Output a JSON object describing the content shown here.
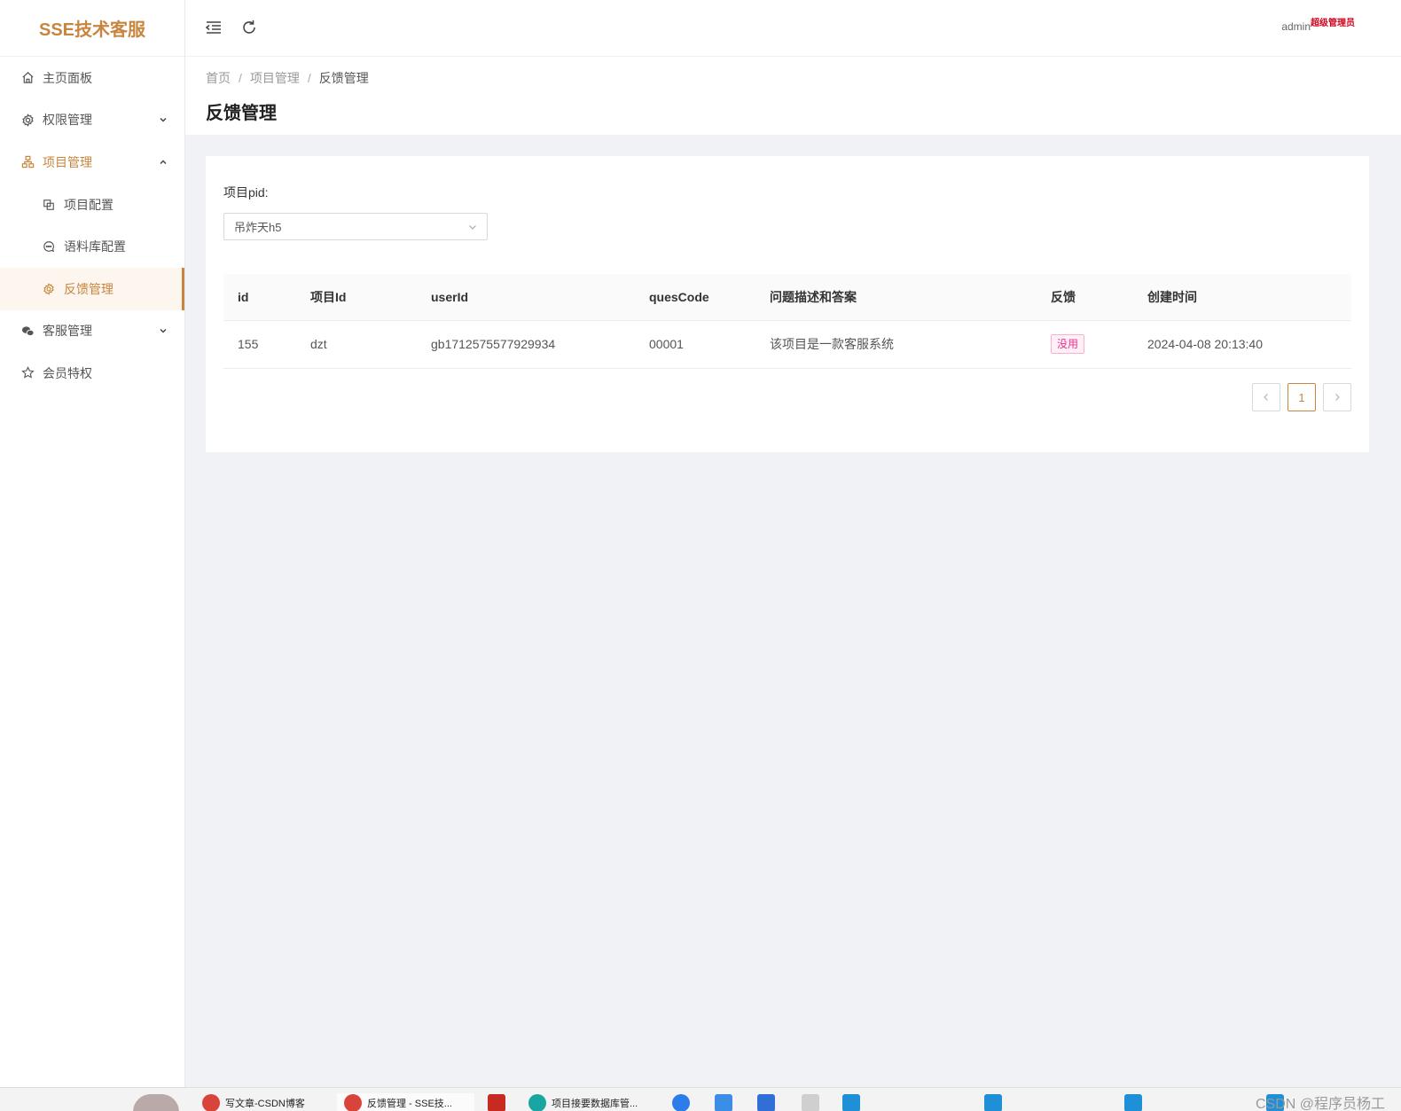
{
  "app": {
    "logo_text": "SSE技术客服",
    "accent_color": "#c8853f"
  },
  "sidebar": {
    "items": [
      {
        "label": "主页面板",
        "icon": "home-icon"
      },
      {
        "label": "权限管理",
        "icon": "gear-icon"
      },
      {
        "label": "项目管理",
        "icon": "org-chart-icon"
      },
      {
        "label": "项目配置",
        "icon": "copy-icon"
      },
      {
        "label": "语料库配置",
        "icon": "chat-bubble-icon"
      },
      {
        "label": "反馈管理",
        "icon": "gear-icon"
      },
      {
        "label": "客服管理",
        "icon": "wechat-icon"
      },
      {
        "label": "会员特权",
        "icon": "star-icon"
      }
    ]
  },
  "header": {
    "username": "admin",
    "role": "超级管理员"
  },
  "breadcrumb": {
    "home": "首页",
    "parent": "项目管理",
    "current": "反馈管理"
  },
  "page": {
    "title": "反馈管理"
  },
  "filter": {
    "label": "项目pid:",
    "selected": "吊炸天h5"
  },
  "table": {
    "headers": {
      "id": "id",
      "project_id": "项目Id",
      "user_id": "userId",
      "ques_code": "quesCode",
      "desc": "问题描述和答案",
      "feedback": "反馈",
      "created": "创建时间"
    },
    "rows": [
      {
        "id": "155",
        "project_id": "dzt",
        "user_id": "gb1712575577929934",
        "ques_code": "00001",
        "desc": "该项目是一款客服系统",
        "feedback": "没用",
        "created": "2024-04-08 20:13:40"
      }
    ]
  },
  "pagination": {
    "current_page": "1"
  },
  "taskbar": {
    "items": [
      {
        "label": "写文章-CSDN博客"
      },
      {
        "label": "反馈管理 - SSE技..."
      },
      {
        "label": "项目接要数据库管..."
      }
    ],
    "watermark": "CSDN @程序员杨工"
  }
}
